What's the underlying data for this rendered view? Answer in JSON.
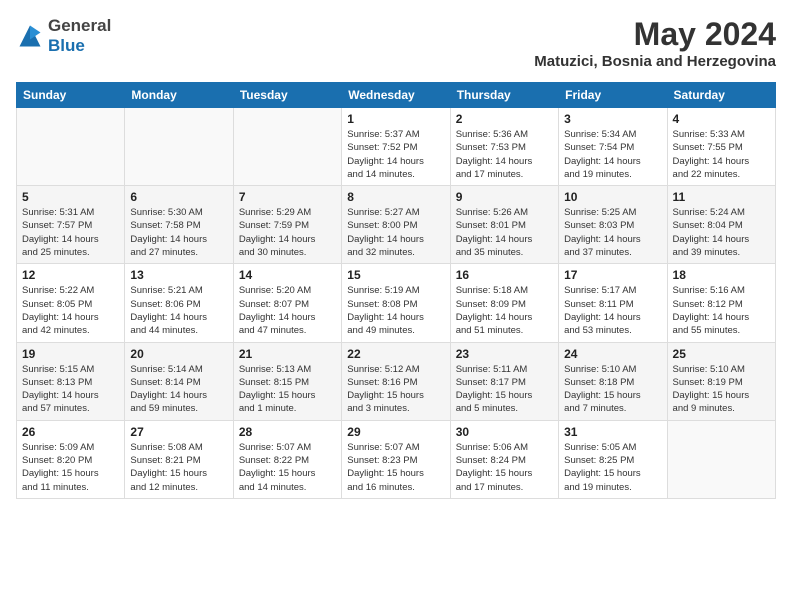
{
  "header": {
    "logo_general": "General",
    "logo_blue": "Blue",
    "month_year": "May 2024",
    "location": "Matuzici, Bosnia and Herzegovina"
  },
  "weekdays": [
    "Sunday",
    "Monday",
    "Tuesday",
    "Wednesday",
    "Thursday",
    "Friday",
    "Saturday"
  ],
  "weeks": [
    [
      {
        "day": "",
        "info": ""
      },
      {
        "day": "",
        "info": ""
      },
      {
        "day": "",
        "info": ""
      },
      {
        "day": "1",
        "info": "Sunrise: 5:37 AM\nSunset: 7:52 PM\nDaylight: 14 hours\nand 14 minutes."
      },
      {
        "day": "2",
        "info": "Sunrise: 5:36 AM\nSunset: 7:53 PM\nDaylight: 14 hours\nand 17 minutes."
      },
      {
        "day": "3",
        "info": "Sunrise: 5:34 AM\nSunset: 7:54 PM\nDaylight: 14 hours\nand 19 minutes."
      },
      {
        "day": "4",
        "info": "Sunrise: 5:33 AM\nSunset: 7:55 PM\nDaylight: 14 hours\nand 22 minutes."
      }
    ],
    [
      {
        "day": "5",
        "info": "Sunrise: 5:31 AM\nSunset: 7:57 PM\nDaylight: 14 hours\nand 25 minutes."
      },
      {
        "day": "6",
        "info": "Sunrise: 5:30 AM\nSunset: 7:58 PM\nDaylight: 14 hours\nand 27 minutes."
      },
      {
        "day": "7",
        "info": "Sunrise: 5:29 AM\nSunset: 7:59 PM\nDaylight: 14 hours\nand 30 minutes."
      },
      {
        "day": "8",
        "info": "Sunrise: 5:27 AM\nSunset: 8:00 PM\nDaylight: 14 hours\nand 32 minutes."
      },
      {
        "day": "9",
        "info": "Sunrise: 5:26 AM\nSunset: 8:01 PM\nDaylight: 14 hours\nand 35 minutes."
      },
      {
        "day": "10",
        "info": "Sunrise: 5:25 AM\nSunset: 8:03 PM\nDaylight: 14 hours\nand 37 minutes."
      },
      {
        "day": "11",
        "info": "Sunrise: 5:24 AM\nSunset: 8:04 PM\nDaylight: 14 hours\nand 39 minutes."
      }
    ],
    [
      {
        "day": "12",
        "info": "Sunrise: 5:22 AM\nSunset: 8:05 PM\nDaylight: 14 hours\nand 42 minutes."
      },
      {
        "day": "13",
        "info": "Sunrise: 5:21 AM\nSunset: 8:06 PM\nDaylight: 14 hours\nand 44 minutes."
      },
      {
        "day": "14",
        "info": "Sunrise: 5:20 AM\nSunset: 8:07 PM\nDaylight: 14 hours\nand 47 minutes."
      },
      {
        "day": "15",
        "info": "Sunrise: 5:19 AM\nSunset: 8:08 PM\nDaylight: 14 hours\nand 49 minutes."
      },
      {
        "day": "16",
        "info": "Sunrise: 5:18 AM\nSunset: 8:09 PM\nDaylight: 14 hours\nand 51 minutes."
      },
      {
        "day": "17",
        "info": "Sunrise: 5:17 AM\nSunset: 8:11 PM\nDaylight: 14 hours\nand 53 minutes."
      },
      {
        "day": "18",
        "info": "Sunrise: 5:16 AM\nSunset: 8:12 PM\nDaylight: 14 hours\nand 55 minutes."
      }
    ],
    [
      {
        "day": "19",
        "info": "Sunrise: 5:15 AM\nSunset: 8:13 PM\nDaylight: 14 hours\nand 57 minutes."
      },
      {
        "day": "20",
        "info": "Sunrise: 5:14 AM\nSunset: 8:14 PM\nDaylight: 14 hours\nand 59 minutes."
      },
      {
        "day": "21",
        "info": "Sunrise: 5:13 AM\nSunset: 8:15 PM\nDaylight: 15 hours\nand 1 minute."
      },
      {
        "day": "22",
        "info": "Sunrise: 5:12 AM\nSunset: 8:16 PM\nDaylight: 15 hours\nand 3 minutes."
      },
      {
        "day": "23",
        "info": "Sunrise: 5:11 AM\nSunset: 8:17 PM\nDaylight: 15 hours\nand 5 minutes."
      },
      {
        "day": "24",
        "info": "Sunrise: 5:10 AM\nSunset: 8:18 PM\nDaylight: 15 hours\nand 7 minutes."
      },
      {
        "day": "25",
        "info": "Sunrise: 5:10 AM\nSunset: 8:19 PM\nDaylight: 15 hours\nand 9 minutes."
      }
    ],
    [
      {
        "day": "26",
        "info": "Sunrise: 5:09 AM\nSunset: 8:20 PM\nDaylight: 15 hours\nand 11 minutes."
      },
      {
        "day": "27",
        "info": "Sunrise: 5:08 AM\nSunset: 8:21 PM\nDaylight: 15 hours\nand 12 minutes."
      },
      {
        "day": "28",
        "info": "Sunrise: 5:07 AM\nSunset: 8:22 PM\nDaylight: 15 hours\nand 14 minutes."
      },
      {
        "day": "29",
        "info": "Sunrise: 5:07 AM\nSunset: 8:23 PM\nDaylight: 15 hours\nand 16 minutes."
      },
      {
        "day": "30",
        "info": "Sunrise: 5:06 AM\nSunset: 8:24 PM\nDaylight: 15 hours\nand 17 minutes."
      },
      {
        "day": "31",
        "info": "Sunrise: 5:05 AM\nSunset: 8:25 PM\nDaylight: 15 hours\nand 19 minutes."
      },
      {
        "day": "",
        "info": ""
      }
    ]
  ]
}
